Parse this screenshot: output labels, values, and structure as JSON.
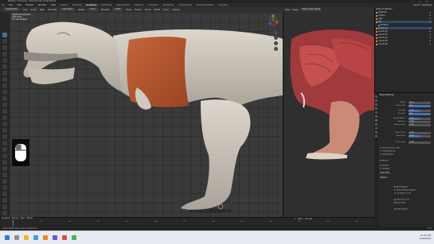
{
  "window": {
    "title": "Blender* [C:\\Users\\...\\Trex_Muscle_Sculpt.blend]"
  },
  "menu": {
    "items": [
      "File",
      "Edit",
      "Render",
      "Window",
      "Help"
    ],
    "tabs": [
      "Layout",
      "Modeling",
      "Sculpting",
      "UV Editing",
      "Texture Paint",
      "Shading",
      "Animation",
      "Rendering",
      "Compositing",
      "Geometry Nodes",
      "Scripting"
    ],
    "active_tab": "Sculpting",
    "scene": "Scene",
    "view_layer": "ViewLayer"
  },
  "viewport_header": {
    "mode": "Sculpt Mode",
    "view": "View",
    "sculpt": "Sculpt",
    "mask": "Mask",
    "face_sets": "Face Sets",
    "brush_name": "Clay Strips",
    "radius_label": "Radius",
    "radius_value": "50 px",
    "strength_label": "Strength",
    "strength_value": "0.500",
    "brush": "Brush",
    "texture": "Texture",
    "stroke": "Stroke",
    "falloff": "Falloff",
    "cursor": "Cursor",
    "options": "Options"
  },
  "viewport_info": {
    "line1": "Right Orthographic",
    "line2": "(187) trex",
    "line3": "10 Centimeters"
  },
  "ref_header": {
    "view": "View",
    "image": "Image",
    "name": "T.Rex muscle ref.jpg"
  },
  "outliner": {
    "header": "Scene Collection",
    "rows": [
      {
        "label": "Collection",
        "selected": false
      },
      {
        "label": "Camera",
        "selected": false
      },
      {
        "label": "Light",
        "selected": false
      },
      {
        "label": "trex",
        "selected": true
      },
      {
        "label": "Modifiers",
        "selected": false
      },
      {
        "label": "muscle_01",
        "selected": true
      },
      {
        "label": "muscle_02",
        "selected": false
      },
      {
        "label": "muscle_03",
        "selected": false
      },
      {
        "label": "muscle_04",
        "selected": false
      },
      {
        "label": "muscle_05",
        "selected": false
      },
      {
        "label": "muscle_06",
        "selected": false
      }
    ]
  },
  "properties": {
    "section1": "Brush Settings",
    "rows": [
      {
        "k": "Radius",
        "v": "50 px",
        "style": "plain"
      },
      {
        "k": "Radius Unit",
        "v": "View",
        "style": "blue"
      },
      {
        "k": "Strength",
        "v": "0.500",
        "style": "fill",
        "fill": 0.5
      },
      {
        "k": "Direction",
        "v": "Add",
        "style": "blue"
      },
      {
        "k": "Normal Radius",
        "v": "0.500",
        "style": "fill",
        "fill": 0.5
      },
      {
        "k": "Hardness",
        "v": "0.000",
        "style": "plain"
      },
      {
        "k": "Auto-Smooth",
        "v": "0.000",
        "style": "plain"
      },
      {
        "k": "Plane Offset",
        "v": "0.000",
        "style": "plain"
      },
      {
        "k": "Plane Trim",
        "v": "0.500",
        "style": "fill",
        "fill": 0.5
      },
      {
        "k": "Tilt Strength",
        "v": "0.000",
        "style": "plain"
      }
    ],
    "checks": [
      {
        "label": "Use Front Faces Only",
        "on": false
      },
      {
        "label": "Original Normal",
        "on": false
      },
      {
        "label": "Original Plane",
        "on": false
      },
      {
        "label": "Manual",
        "on": true
      },
      {
        "label": "Smooth",
        "on": false
      },
      {
        "label": "Topology",
        "on": false
      }
    ],
    "section2": "Symmetry",
    "section3": "Options",
    "options": [
      {
        "label": "Fast Navigate",
        "on": true
      },
      {
        "label": "Delay Viewport Updates",
        "on": false
      },
      {
        "label": "Use Deform Only",
        "on": false
      },
      {
        "label": "Show Face Sets",
        "on": true
      },
      {
        "label": "Show Mask",
        "on": true
      },
      {
        "label": "Unified Brush",
        "on": true
      }
    ]
  },
  "timeline": {
    "labels": [
      "Playback",
      "Keying",
      "View",
      "Marker"
    ],
    "ticks": [
      "0",
      "20",
      "40",
      "60",
      "80",
      "100",
      "120",
      "140",
      "160",
      "180",
      "200",
      "220",
      "240"
    ],
    "start_label": "Start",
    "start": "1",
    "end_label": "End",
    "end": "250",
    "current": "1"
  },
  "status": {
    "left": "Select   Rotate View   Sculpt Context Menu",
    "right": "3.4.1"
  },
  "taskbar": {
    "time": "11:42 AM",
    "date": "1/26/2023"
  },
  "colors": {
    "accent": "#4772b3",
    "muscle": "#b4552e",
    "selection": "#334766"
  }
}
